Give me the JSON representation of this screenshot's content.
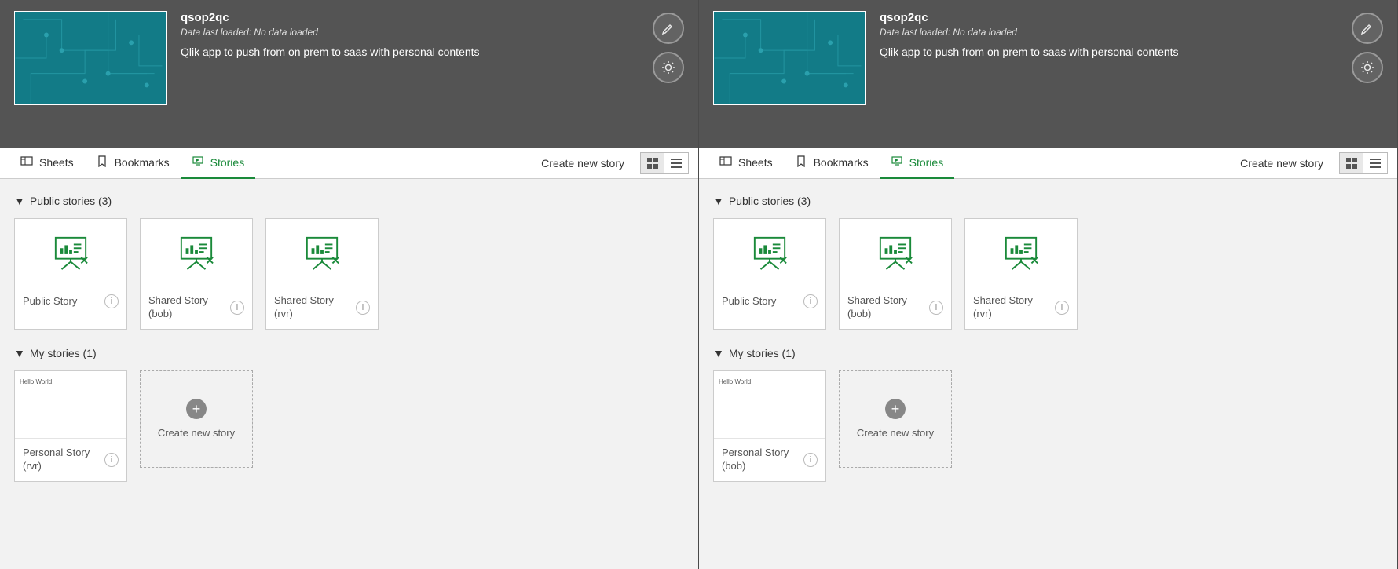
{
  "app": {
    "title": "qsop2qc",
    "data_loaded": "Data last loaded: No data loaded",
    "description": "Qlik app to push from on prem to saas with personal contents"
  },
  "tabs": {
    "sheets": "Sheets",
    "bookmarks": "Bookmarks",
    "stories": "Stories"
  },
  "actions": {
    "create_new_story": "Create new story"
  },
  "sections": {
    "public": {
      "title": "Public stories (3)"
    },
    "mine": {
      "title": "My stories (1)"
    }
  },
  "left": {
    "public_stories": [
      {
        "label": "Public Story",
        "stacked": false
      },
      {
        "label": "Shared Story (bob)",
        "stacked": true
      },
      {
        "label": "Shared Story (rvr)",
        "stacked": true
      }
    ],
    "my_stories": [
      {
        "label": "Personal Story (rvr)",
        "preview_line1": "Hello World!",
        "preview_line2": ""
      }
    ]
  },
  "right": {
    "public_stories": [
      {
        "label": "Public Story",
        "stacked": false
      },
      {
        "label": "Shared Story (bob)",
        "stacked": true
      },
      {
        "label": "Shared Story (rvr)",
        "stacked": true
      }
    ],
    "my_stories": [
      {
        "label": "Personal Story (bob)",
        "preview_line1": "Hello World!",
        "preview_line2": ""
      }
    ]
  },
  "add_card": {
    "label": "Create new story"
  }
}
